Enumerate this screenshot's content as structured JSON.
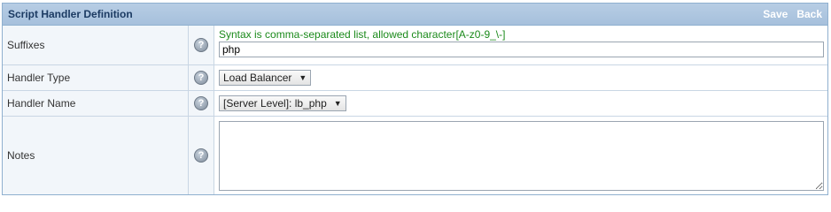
{
  "panel": {
    "title": "Script Handler Definition",
    "save_label": "Save",
    "back_label": "Back"
  },
  "rows": {
    "suffixes": {
      "label": "Suffixes",
      "hint": "Syntax is comma-separated list, allowed character[A-z0-9_\\-]",
      "value": "php"
    },
    "handler_type": {
      "label": "Handler Type",
      "selected": "Load Balancer"
    },
    "handler_name": {
      "label": "Handler Name",
      "selected": "[Server Level]: lb_php"
    },
    "notes": {
      "label": "Notes",
      "value": ""
    }
  },
  "help_glyph": "?",
  "arrow_glyph": "▼"
}
